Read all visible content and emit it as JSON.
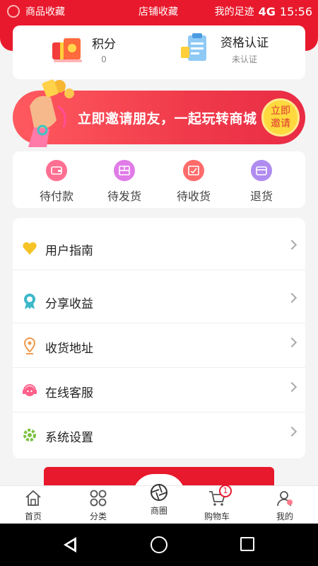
{
  "status_bar": {
    "left_text": "商品收藏",
    "center_text": "店铺收藏",
    "right_text": "我的足迹",
    "network": "4G",
    "time": "15:56"
  },
  "header": {
    "points": {
      "title": "积分",
      "value": "0"
    },
    "verify": {
      "title": "资格认证",
      "status": "未认证"
    }
  },
  "banner": {
    "text": "立即邀请朋友，一起玩转商城",
    "button_line1": "立即",
    "button_line2": "邀请"
  },
  "orders": [
    {
      "label": "待付款",
      "color": "#ff6f91"
    },
    {
      "label": "待发货",
      "color": "#e07be8"
    },
    {
      "label": "待收货",
      "color": "#ff6b6b"
    },
    {
      "label": "退货",
      "color": "#b08cf0"
    }
  ],
  "menu": [
    {
      "label": "用户指南",
      "icon": "heart-icon",
      "color": "#f6c327"
    },
    {
      "label": "分享收益",
      "icon": "ribbon-icon",
      "color": "#3bb8c9"
    },
    {
      "label": "收货地址",
      "icon": "location-pin-icon",
      "color": "#f29a4b"
    },
    {
      "label": "在线客服",
      "icon": "headset-icon",
      "color": "#ff5f8a"
    },
    {
      "label": "系统设置",
      "icon": "gear-icon",
      "color": "#7cc241"
    }
  ],
  "tabs": [
    {
      "label": "首页",
      "icon": "home-icon"
    },
    {
      "label": "分类",
      "icon": "grid-icon"
    },
    {
      "label": "商圈",
      "icon": "aperture-icon"
    },
    {
      "label": "购物车",
      "icon": "cart-icon",
      "badge": "1"
    },
    {
      "label": "我的",
      "icon": "user-icon"
    }
  ],
  "colors": {
    "brand": "#e8192c",
    "banner_button": "#ffd93d"
  }
}
